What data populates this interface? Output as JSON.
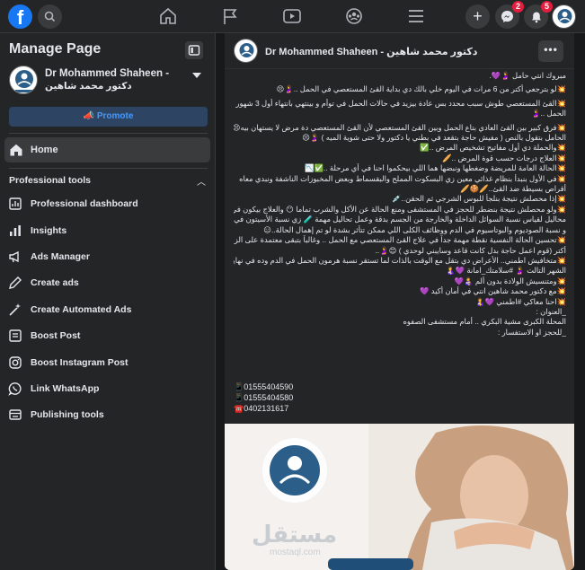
{
  "topbar": {
    "logo_letter": "f",
    "messenger_badge": "2",
    "notifications_badge": "5"
  },
  "sidebar": {
    "title": "Manage Page",
    "page_name_en": "Dr Mohammed Shaheen -",
    "page_name_ar": "دكتور محمد شاهين",
    "promote_label": "Promote",
    "home_label": "Home",
    "section_title": "Professional tools",
    "items": [
      {
        "label": "Professional dashboard",
        "icon": "dashboard-icon"
      },
      {
        "label": "Insights",
        "icon": "insights-icon"
      },
      {
        "label": "Ads Manager",
        "icon": "ads-manager-icon"
      },
      {
        "label": "Create ads",
        "icon": "create-ads-icon"
      },
      {
        "label": "Create Automated Ads",
        "icon": "magic-wand-icon"
      },
      {
        "label": "Boost Post",
        "icon": "boost-post-icon"
      },
      {
        "label": "Boost Instagram Post",
        "icon": "instagram-icon"
      },
      {
        "label": "Link WhatsApp",
        "icon": "whatsapp-icon"
      },
      {
        "label": "Publishing tools",
        "icon": "publishing-tools-icon"
      }
    ]
  },
  "post": {
    "author": "Dr Mohammed Shaheen - دكتور محمد شاهين",
    "more_label": "•••",
    "body_lines": [
      "مبروك انتي حامل 🤰💜.",
      "💥لو بترجعي أكتر من 6 مرات في اليوم خلي بالك دي بداية القئ المستعصي في الحمل ..🤰😣",
      "💥القئ المستعصي طوش سبب محدد بس عادة بيزيد في حالات الحمل في توأم و بينتهي بانتهاء أول 3 شهور من",
      "الحمل ..🤰",
      "💥فرق كبير بين القئ العادي بتاع الحمل وبين القئ المستعصي لأن القئ المستعصي دة مرض لا يستهان بيه😣",
      "الحامل بتقول بالنص ( مفيش حاجة بتقعد في بطني يا دكتور ولا حتى شوية الميه ) 🤰😣",
      "💥والحملة دي أول مفاتيح تشخيص المرض ..✅",
      "💥العلاج درجات حسب قوة المرض ..🥖",
      "💥الحالة العامة للمريضة وضغطها ونبضها هما اللي بيحكموا احنا في أي مرحلة ..✅📉",
      "💥في الأول بنبدأ بنظام غذائي معين زي البسكوت المملح والبقسماط وبعض المخبوزات الناشفة ونبدي معاه",
      "أقراص بسيطة ضد القئ..🥖🍪🥖",
      "💥إذا محصلش نتيجة بنلجأ للبوس الشرجي ثم الحقن..💉",
      "💥ولو محصلش نتيجة بنضطر للحجز في المستشفى ومنع الحالة عن الأكل والشرب تماما 😶 والعلاج بيكون في",
      "محاليل لقياس نسبة السوائل الداخلة والخارجة من الجسم بدقة وعمل تحاليل مهمة 🧪 زي نسبة الأسيتون في البول",
      "و نسبة الصوديوم والبوتاسيوم في الدم ووظائف الكلى اللي ممكن تتأثر بشدة لو تم إهمال الحالة..😑",
      "💥تحسين الحالة النفسية نقطة مهمة جداً في علاج القئ المستعصي مع الحمل .. وغالباً بتبقى معتمدة على الزوج",
      "أكتر (قوم اعمل حاجة بدل كانت قاعد وسايبني لوحدي ) 😊🤰..",
      "💥متخافيش اطمني.. الأعراض دي بتقل مع الوقت بالذات  لما تستقر نسبة هرمون الحمل في الدم وده في نهاية",
      "الشهر التالت 🤰 #سلامتك_امانة 💜🤱",
      "💥ومتنسيش الولادة بدون ألم 👩‍🍼💜",
      "💥مع دكتور محمد شاهين انتي في أمان أكيد 💜",
      "💥احنا معاكي #اطمني 💜🤱",
      "_العنوان :",
      "المحلة الكبرى مشية البكري .. أمام مستشفى الصفوه",
      "_للحجز او الاستفسار :"
    ],
    "phones": [
      "📱01555404590",
      "📱01555404580",
      "☎️0402131617"
    ],
    "image": {
      "watermark": "مستقل",
      "watermark_sub": "mostaql.com"
    }
  },
  "colors": {
    "background": "#18191a",
    "surface": "#242526",
    "accent": "#1877f2",
    "badge": "#e41e3f"
  }
}
